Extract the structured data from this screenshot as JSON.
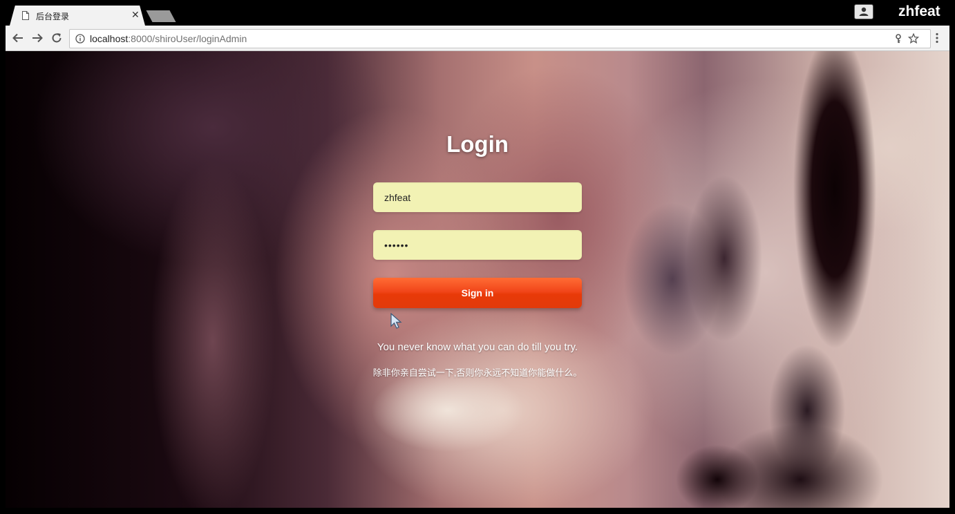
{
  "browser": {
    "tab_title": "后台登录",
    "close_glyph": "✕",
    "profile_name": "zhfeat",
    "url_host": "localhost",
    "url_path": ":8000/shiroUser/loginAdmin",
    "icons": [
      "page-icon",
      "close-icon",
      "back-arrow-icon",
      "forward-arrow-icon",
      "reload-icon",
      "info-icon",
      "key-icon",
      "star-icon",
      "menu-icon",
      "profile-icon"
    ]
  },
  "login": {
    "title": "Login",
    "username_value": "zhfeat",
    "password_value": "••••••",
    "signin_label": "Sign in",
    "motto_en": "You never know what you can do till you try.",
    "motto_zh": "除非你亲自尝试一下,否则你永远不知道你能做什么。"
  },
  "colors": {
    "field_background": "#f2f2b4",
    "signin_button": "#e83a08",
    "text_light": "#ffffff"
  }
}
